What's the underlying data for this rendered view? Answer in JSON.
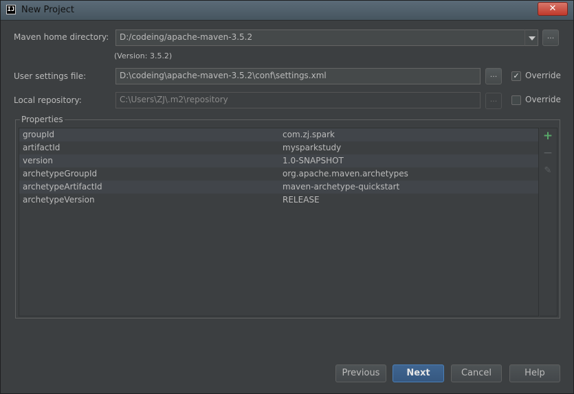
{
  "window": {
    "title": "New Project",
    "close_symbol": "✕",
    "app_icon_text": "IJ"
  },
  "maven_home": {
    "label": "Maven home directory:",
    "value": "D:/codeing/apache-maven-3.5.2",
    "version_text": "(Version: 3.5.2)",
    "browse": "..."
  },
  "user_settings": {
    "label": "User settings file:",
    "value": "D:\\codeing\\apache-maven-3.5.2\\conf\\settings.xml",
    "browse": "...",
    "override_label": "Override",
    "override_checked": true
  },
  "local_repo": {
    "label": "Local repository:",
    "value": "C:\\Users\\ZJ\\.m2\\repository",
    "browse": "...",
    "override_label": "Override",
    "override_checked": false
  },
  "properties": {
    "title": "Properties",
    "rows": [
      {
        "key": "groupId",
        "value": "com.zj.spark"
      },
      {
        "key": "artifactId",
        "value": "mysparkstudy"
      },
      {
        "key": "version",
        "value": "1.0-SNAPSHOT"
      },
      {
        "key": "archetypeGroupId",
        "value": "org.apache.maven.archetypes"
      },
      {
        "key": "archetypeArtifactId",
        "value": "maven-archetype-quickstart"
      },
      {
        "key": "archetypeVersion",
        "value": "RELEASE"
      }
    ],
    "tools": {
      "add": "+",
      "remove": "−",
      "edit": "✎"
    }
  },
  "buttons": {
    "previous": "Previous",
    "next": "Next",
    "cancel": "Cancel",
    "help": "Help"
  },
  "colors": {
    "background": "#3c3f41",
    "text": "#bbbbbb",
    "accent": "#365880",
    "add_green": "#59a869"
  }
}
